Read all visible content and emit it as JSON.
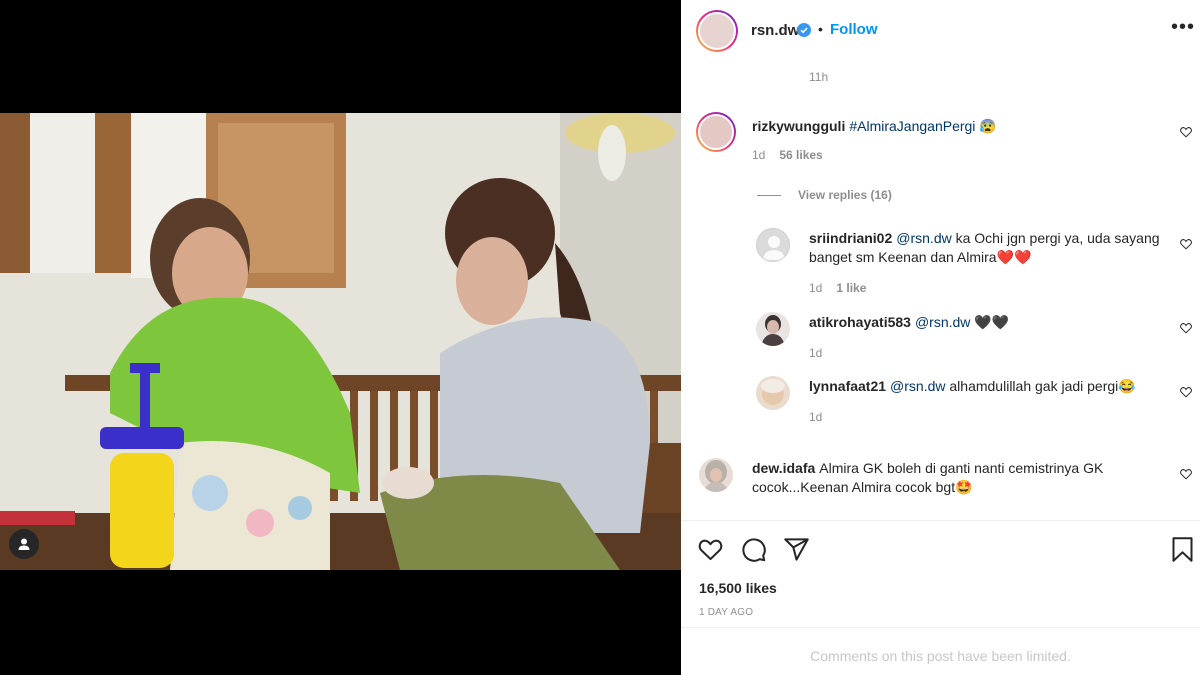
{
  "header": {
    "username": "rsn.dw",
    "separator": "•",
    "follow_label": "Follow",
    "more_label": "•••"
  },
  "caption": {
    "time": "11h"
  },
  "comments": [
    {
      "username": "rizkywungguli",
      "text": "#AlmiraJanganPergi",
      "emoji": "😰",
      "time": "1d",
      "likes": "56 likes",
      "view_replies": "View replies (16)"
    }
  ],
  "replies": [
    {
      "username": "sriindriani02",
      "mention": "@rsn.dw",
      "text": " ka Ochi jgn pergi ya, uda sayang banget sm Keenan dan Almira",
      "emoji": "❤️❤️",
      "time": "1d",
      "likes": "1 like"
    },
    {
      "username": "atikrohayati583",
      "mention": "@rsn.dw",
      "text": " ",
      "emoji": "🖤🖤",
      "time": "1d"
    },
    {
      "username": "lynnafaat21",
      "mention": "@rsn.dw",
      "text": " alhamdulillah gak jadi pergi",
      "emoji": "😂",
      "time": "1d"
    }
  ],
  "comment2": {
    "username": "dew.idafa",
    "text": "Almira GK boleh di ganti nanti cemistrinya GK cocok...Keenan Almira cocok bgt",
    "emoji": "🤩"
  },
  "post": {
    "likes": "16,500 likes",
    "posted": "1 DAY AGO",
    "limited": "Comments on this post have been limited."
  },
  "colors": {
    "accent": "#0095f6",
    "text": "#262626",
    "muted": "#8e8e8e",
    "link": "#00376b"
  },
  "icons": [
    "verified-badge-icon",
    "more-options-icon",
    "heart-icon",
    "comment-icon",
    "share-icon",
    "bookmark-icon",
    "user-tag-icon"
  ]
}
